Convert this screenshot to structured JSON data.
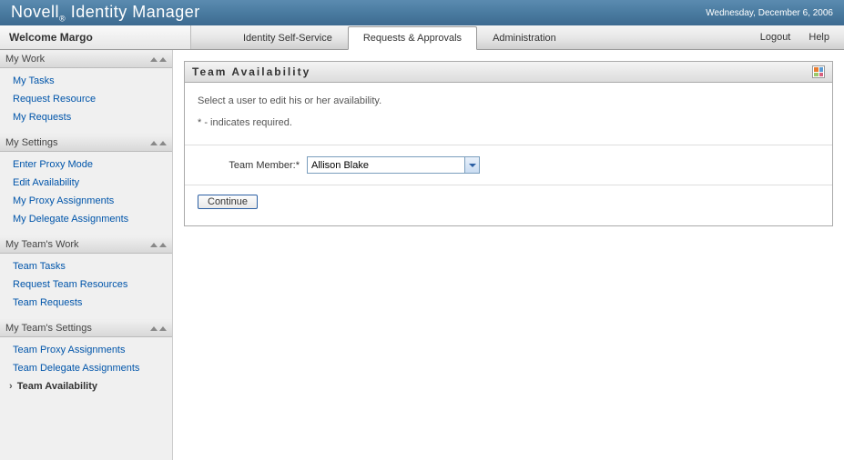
{
  "header": {
    "title_brand": "Novell",
    "title_product": "Identity Manager",
    "date_text": "Wednesday, December 6, 2006"
  },
  "welcome": "Welcome Margo",
  "tabs": [
    {
      "label": "Identity Self-Service",
      "active": false
    },
    {
      "label": "Requests & Approvals",
      "active": true
    },
    {
      "label": "Administration",
      "active": false
    }
  ],
  "top_links": {
    "logout": "Logout",
    "help": "Help"
  },
  "sidebar": [
    {
      "title": "My Work",
      "items": [
        {
          "label": "My Tasks",
          "active": false
        },
        {
          "label": "Request Resource",
          "active": false
        },
        {
          "label": "My Requests",
          "active": false
        }
      ]
    },
    {
      "title": "My Settings",
      "items": [
        {
          "label": "Enter Proxy Mode",
          "active": false
        },
        {
          "label": "Edit Availability",
          "active": false
        },
        {
          "label": "My Proxy Assignments",
          "active": false
        },
        {
          "label": "My Delegate Assignments",
          "active": false
        }
      ]
    },
    {
      "title": "My Team's Work",
      "items": [
        {
          "label": "Team Tasks",
          "active": false
        },
        {
          "label": "Request Team Resources",
          "active": false
        },
        {
          "label": "Team Requests",
          "active": false
        }
      ]
    },
    {
      "title": "My Team's Settings",
      "items": [
        {
          "label": "Team Proxy Assignments",
          "active": false
        },
        {
          "label": "Team Delegate Assignments",
          "active": false
        },
        {
          "label": "Team Availability",
          "active": true
        }
      ]
    }
  ],
  "panel": {
    "title": "Team Availability",
    "instruction": "Select a user to edit his or her availability.",
    "required_note": "* - indicates required.",
    "form": {
      "team_member_label": "Team Member:*",
      "team_member_value": "Allison Blake"
    },
    "continue_label": "Continue"
  }
}
